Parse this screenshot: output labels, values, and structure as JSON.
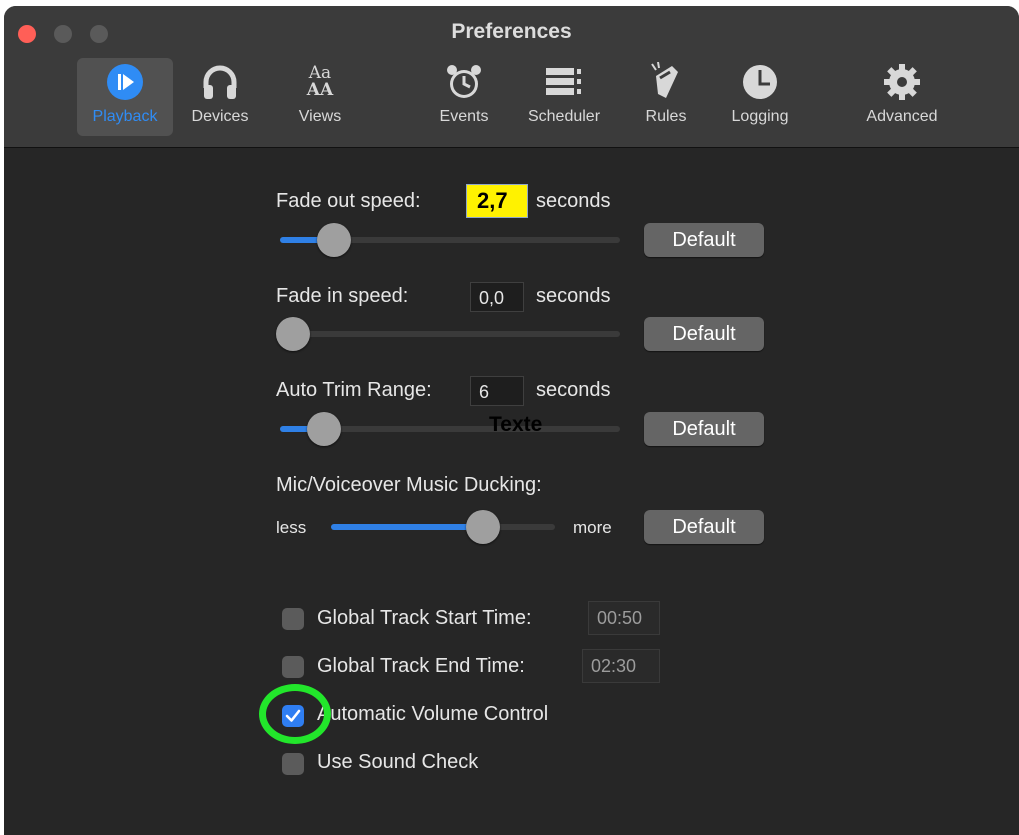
{
  "window": {
    "title": "Preferences"
  },
  "toolbar": {
    "items": [
      {
        "label": "Playback",
        "icon": "playback-icon",
        "active": true
      },
      {
        "label": "Devices",
        "icon": "headphones-icon"
      },
      {
        "label": "Views",
        "icon": "text-size-icon",
        "glyph_top": "Aa",
        "glyph_bottom": "AA"
      },
      {
        "label": "Events",
        "icon": "alarm-clock-icon"
      },
      {
        "label": "Scheduler",
        "icon": "numbered-list-icon"
      },
      {
        "label": "Rules",
        "icon": "rules-icon"
      },
      {
        "label": "Logging",
        "icon": "clock-icon"
      },
      {
        "label": "Advanced",
        "icon": "gear-icon"
      }
    ]
  },
  "fade_out": {
    "label": "Fade out speed:",
    "value": "2,7",
    "unit": "seconds",
    "default_label": "Default",
    "slider_level": 0.16
  },
  "fade_in": {
    "label": "Fade in speed:",
    "value": "0,0",
    "unit": "seconds",
    "default_label": "Default",
    "slider_level": 0.0
  },
  "auto_trim": {
    "label": "Auto Trim Range:",
    "value": "6",
    "unit": "seconds",
    "default_label": "Default",
    "slider_level": 0.13
  },
  "ducking": {
    "label": "Mic/Voiceover Music Ducking:",
    "less_label": "less",
    "more_label": "more",
    "default_label": "Default",
    "slider_level": 0.68
  },
  "overlay_text": "Texte",
  "options": {
    "global_start": {
      "label": "Global Track Start Time:",
      "value": "00:50",
      "checked": false
    },
    "global_end": {
      "label": "Global Track End Time:",
      "value": "02:30",
      "checked": false
    },
    "auto_volume": {
      "label": "Automatic Volume Control",
      "checked": true
    },
    "sound_check": {
      "label": "Use Sound Check",
      "checked": false
    }
  },
  "colors": {
    "accent": "#2f80e6",
    "highlight": "#fff200",
    "annotation": "#22e62b",
    "background": "#262626"
  }
}
